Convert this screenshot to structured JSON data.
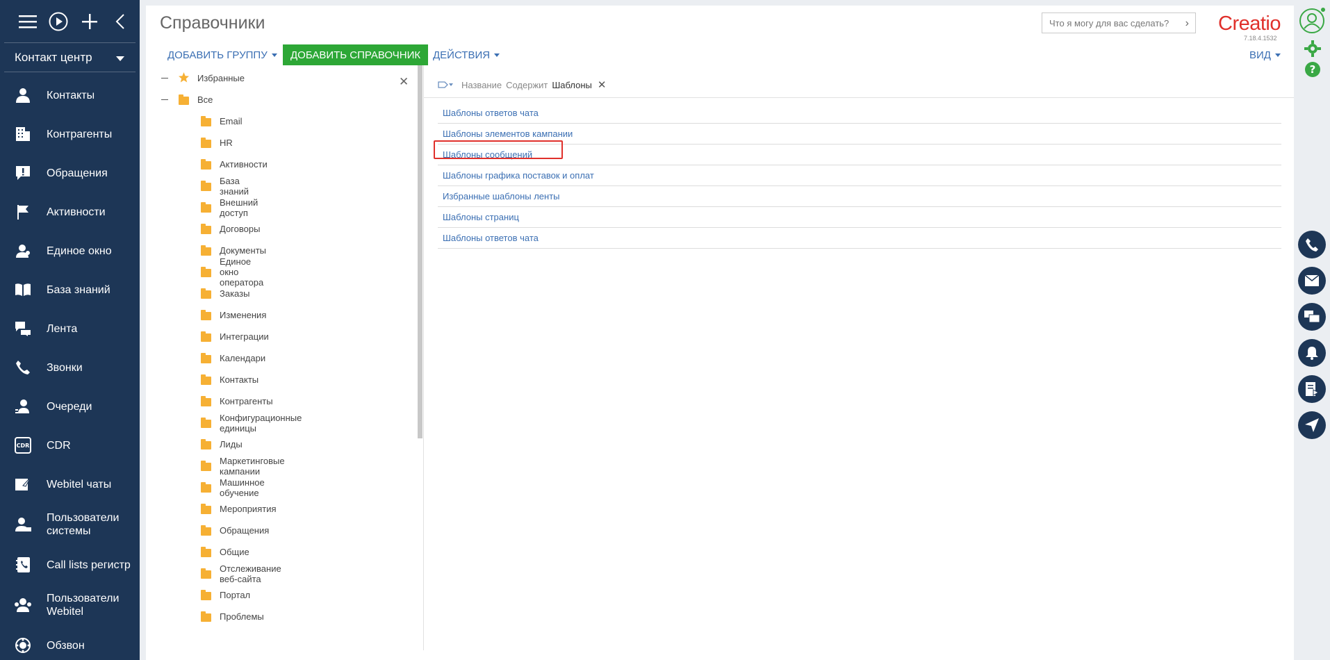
{
  "sidebar": {
    "workspace": "Контакт центр",
    "items": [
      {
        "label": "Контакты",
        "icon": "person-icon"
      },
      {
        "label": "Контрагенты",
        "icon": "building-icon"
      },
      {
        "label": "Обращения",
        "icon": "exclamation-icon"
      },
      {
        "label": "Активности",
        "icon": "flag-icon"
      },
      {
        "label": "Единое окно",
        "icon": "agent-icon"
      },
      {
        "label": "База знаний",
        "icon": "book-icon"
      },
      {
        "label": "Лента",
        "icon": "chat-icon"
      },
      {
        "label": "Звонки",
        "icon": "phone-icon"
      },
      {
        "label": "Очереди",
        "icon": "queue-icon"
      },
      {
        "label": "CDR",
        "icon": "cdr-icon"
      },
      {
        "label": "Webitel чаты",
        "icon": "send-icon"
      },
      {
        "label": "Пользователи системы",
        "icon": "users-lock-icon"
      },
      {
        "label": "Call lists регистр",
        "icon": "phonebook-icon"
      },
      {
        "label": "Пользователи Webitel",
        "icon": "users-icon"
      },
      {
        "label": "Обзвон",
        "icon": "dial-icon"
      }
    ]
  },
  "header": {
    "title": "Справочники",
    "search_placeholder": "Что я могу для вас сделать?",
    "logo": "Creatio",
    "version": "7.18.4.1532"
  },
  "toolbar": {
    "add_group": "ДОБАВИТЬ ГРУППУ",
    "add_lookup": "ДОБАВИТЬ СПРАВОЧНИК",
    "actions": "ДЕЙСТВИЯ",
    "view": "ВИД"
  },
  "tree": {
    "favorites": "Избранные",
    "all": "Все",
    "folders": [
      "Email",
      "HR",
      "Активности",
      "База знаний",
      "Внешний доступ",
      "Договоры",
      "Документы",
      "Единое окно оператора",
      "Заказы",
      "Изменения",
      "Интеграции",
      "Календари",
      "Контакты",
      "Контрагенты",
      "Конфигурационные единицы",
      "Лиды",
      "Маркетинговые кампании",
      "Машинное обучение",
      "Мероприятия",
      "Обращения",
      "Общие",
      "Отслеживание веб-сайта",
      "Портал",
      "Проблемы"
    ]
  },
  "filter": {
    "field": "Название",
    "operator": "Содержит",
    "value": "Шаблоны"
  },
  "results": [
    "Шаблоны ответов чата",
    "Шаблоны элементов кампании",
    "Шаблоны сообщений",
    "Шаблоны графика поставок и оплат",
    "Избранные шаблоны ленты",
    "Шаблоны страниц",
    "Шаблоны ответов чата"
  ],
  "colors": {
    "sidebar": "#1d3656",
    "accent_green": "#2da736",
    "link": "#3b6fb3",
    "highlight": "#e0302b",
    "folder": "#f6b034"
  }
}
